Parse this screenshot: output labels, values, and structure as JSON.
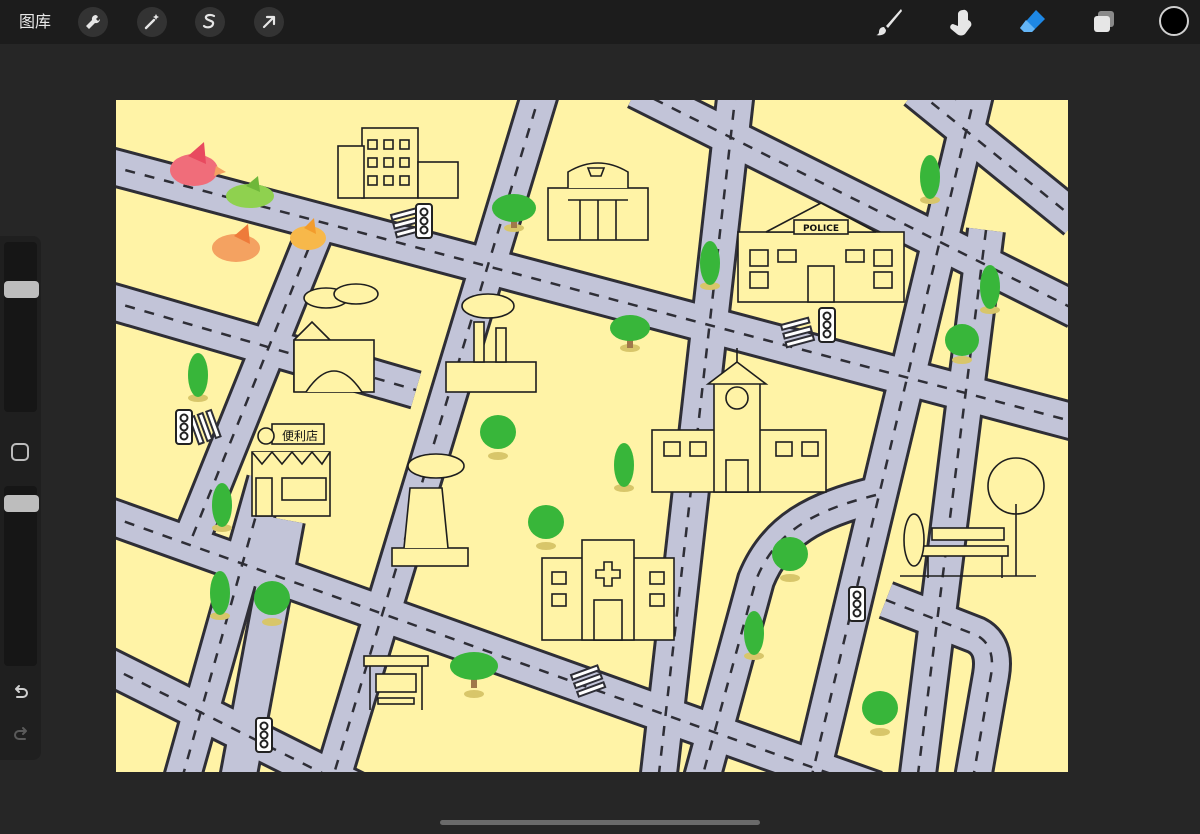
{
  "topbar": {
    "gallery_label": "图库",
    "left_tools": [
      "wrench-icon",
      "magic-wand-icon",
      "selection-icon",
      "transform-arrow-icon"
    ],
    "right_tools": [
      "brush-icon",
      "smudge-icon",
      "eraser-icon",
      "layers-icon"
    ],
    "active_tool": "eraser-icon",
    "accent_color": "#1e88e5",
    "current_color": "#000000"
  },
  "sidebar": {
    "brush_size": 0.1,
    "opacity": 0.05
  },
  "canvas": {
    "background_color": "#fff3a6",
    "road_color": "#c2c4d8",
    "signs": {
      "police": "POLICE",
      "store": "便利店"
    }
  }
}
